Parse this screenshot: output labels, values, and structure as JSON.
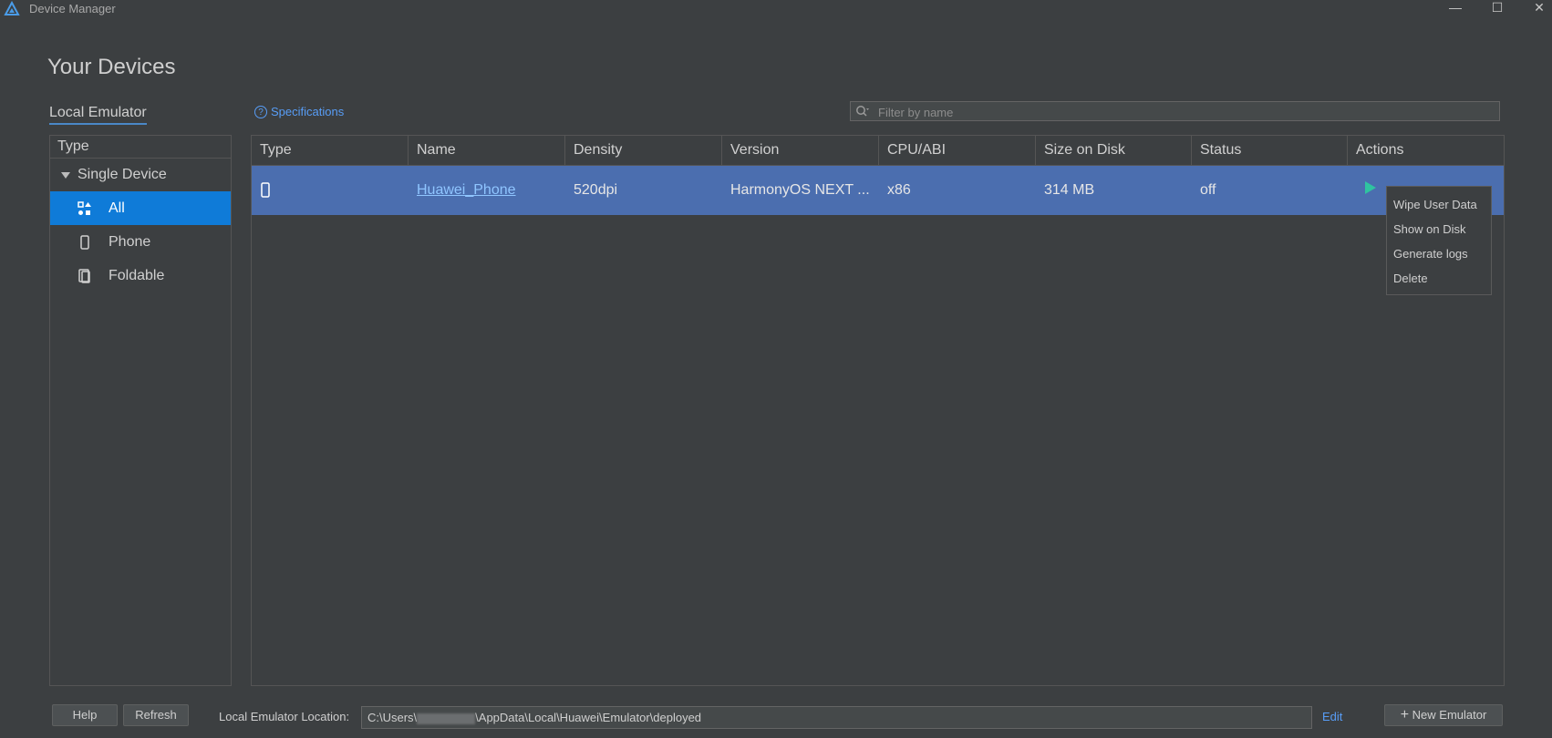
{
  "window": {
    "title": "Device Manager",
    "controls": {
      "minimize": "—",
      "maximize": "☐",
      "close": "✕"
    }
  },
  "page": {
    "title": "Your Devices"
  },
  "tabs": {
    "local": "Local Emulator"
  },
  "toolbar": {
    "specifications_label": "Specifications",
    "filter_placeholder": "Filter by name"
  },
  "sidebar": {
    "header": "Type",
    "group": "Single Device",
    "items": [
      {
        "label": "All",
        "icon": "grid-icon",
        "active": true
      },
      {
        "label": "Phone",
        "icon": "phone-icon",
        "active": false
      },
      {
        "label": "Foldable",
        "icon": "foldable-icon",
        "active": false
      }
    ]
  },
  "table": {
    "columns": [
      "Type",
      "Name",
      "Density",
      "Version",
      "CPU/ABI",
      "Size on Disk",
      "Status",
      "Actions"
    ],
    "rows": [
      {
        "type_icon": "phone-icon",
        "name": "Huawei_Phone",
        "density": "520dpi",
        "version": "HarmonyOS NEXT ...",
        "cpu": "x86",
        "size": "314 MB",
        "status": "off"
      }
    ]
  },
  "context_menu": {
    "items": [
      "Wipe User Data",
      "Show on Disk",
      "Generate logs",
      "Delete"
    ]
  },
  "footer": {
    "help": "Help",
    "refresh": "Refresh",
    "location_label": "Local Emulator Location:",
    "location_prefix": "C:\\Users\\",
    "location_suffix": "\\AppData\\Local\\Huawei\\Emulator\\deployed",
    "edit": "Edit",
    "new_emulator": "New Emulator"
  },
  "colors": {
    "accent": "#0f7bd8",
    "selected_row": "#4b6eaf",
    "link": "#589df6",
    "play": "#2fc4a0"
  }
}
